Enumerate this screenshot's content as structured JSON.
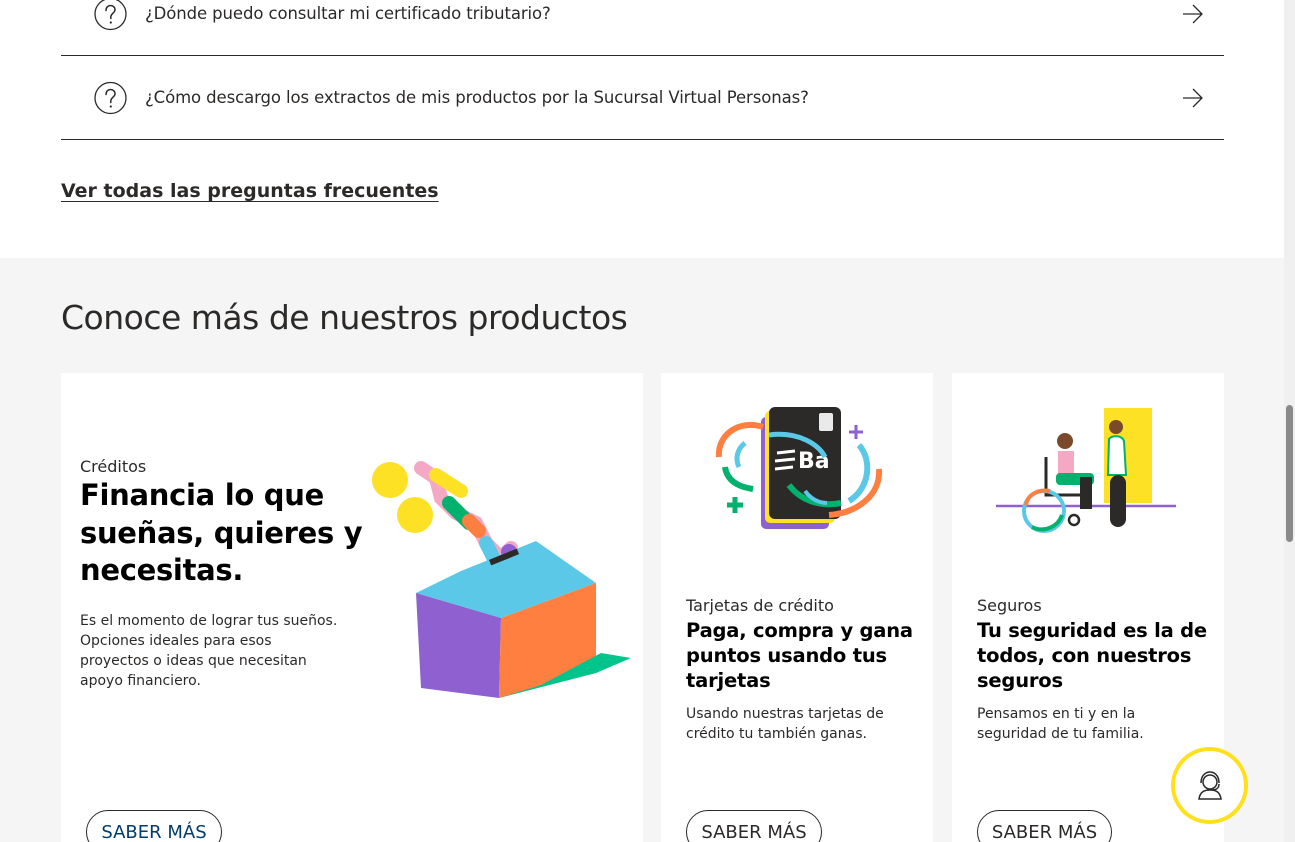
{
  "faq": {
    "items": [
      {
        "question": "¿Dónde puedo consultar mi certificado tributario?"
      },
      {
        "question": "¿Cómo descargo los extractos de mis productos por la Sucursal Virtual Personas?"
      }
    ],
    "see_all_link": "Ver todas las preguntas frecuentes"
  },
  "products": {
    "title": "Conoce más de nuestros productos",
    "cards": [
      {
        "category": "Créditos",
        "heading": "Financia lo que sueñas, quieres y necesitas.",
        "description": "Es el momento de lograr tus sueños. Opciones ideales para esos proyectos o ideas que necesitan apoyo financiero.",
        "button": "SABER MÁS"
      },
      {
        "category": "Tarjetas de crédito",
        "heading": "Paga, compra y gana puntos usando tus tarjetas",
        "description": "Usando nuestras tarjetas de crédito tu también ganas.",
        "button": "SABER MÁS",
        "card_logo_text": "Ba"
      },
      {
        "category": "Seguros",
        "heading": "Tu seguridad es la de todos, con nuestros seguros",
        "description": "Pensamos en ti y en la seguridad de tu familia.",
        "button": "SABER MÁS"
      }
    ]
  },
  "icons": {
    "faq_item": "question-circle-icon",
    "faq_arrow": "arrow-right-icon",
    "chat": "chat-agent-icon"
  },
  "colors": {
    "text": "#2c2a29",
    "section_bg": "#f5f5f5",
    "chat_ring": "#ffe01a",
    "button_text_primary": "#003c6e"
  }
}
